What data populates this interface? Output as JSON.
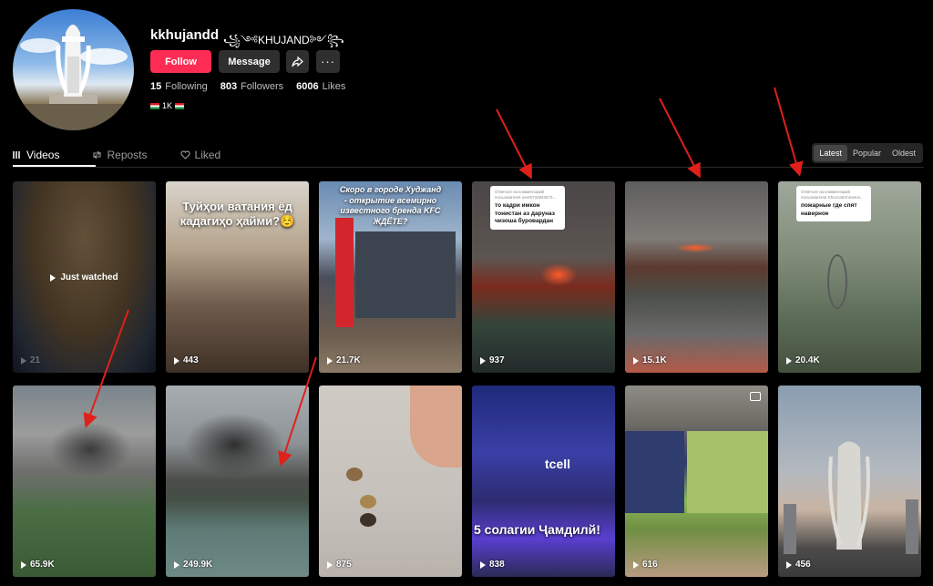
{
  "profile": {
    "username": "kkhujandd",
    "nickname": "꧁༺KHUJAND༻꧂",
    "follow_label": "Follow",
    "message_label": "Message",
    "more_label": "···",
    "following_count": "15",
    "following_label": "Following",
    "followers_count": "803",
    "followers_label": "Followers",
    "likes_count": "6006",
    "likes_label": "Likes",
    "bio": "1K"
  },
  "tabs": [
    {
      "label": "Videos"
    },
    {
      "label": "Reposts"
    },
    {
      "label": "Liked"
    }
  ],
  "sort": [
    "Latest",
    "Popular",
    "Oldest"
  ],
  "videos": [
    {
      "views": "21",
      "overlay": "Just watched"
    },
    {
      "views": "443",
      "overlay": "Туйҳои ватания ёд кадагиҳо ҳайми?☺️"
    },
    {
      "views": "21.7K",
      "overlay": "Скоро в городе Худжанд - открытие всемирно известного бренда KFC ЖДЁТЕ?"
    },
    {
      "views": "937",
      "bubble_title": "Ответьте на комментарий пользователя user5732843573...",
      "bubble_text": "то кадри имкон тонистан аз даруназ чизоша буровардан"
    },
    {
      "views": "15.1K"
    },
    {
      "views": "20.4K",
      "bubble_title": "Ответьте на комментарий пользователя Khucca0Ahmetov...",
      "bubble_text": "пожарные где спят наверное"
    },
    {
      "views": "65.9K"
    },
    {
      "views": "249.9K"
    },
    {
      "views": "875"
    },
    {
      "views": "838",
      "overlay": "5 солагии Ҷамдилй!",
      "brand": "tcell"
    },
    {
      "views": "616"
    },
    {
      "views": "456"
    }
  ],
  "colors": {
    "follow": "#fe2c55",
    "arrow": "#e0201a"
  }
}
